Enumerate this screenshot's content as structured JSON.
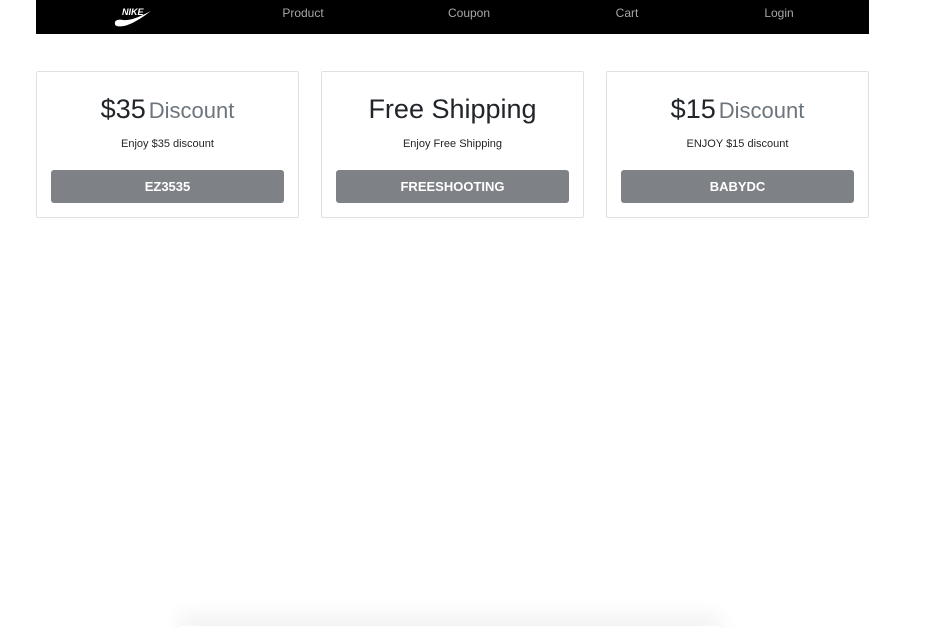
{
  "navbar": {
    "logo_text": "NIKE",
    "links": [
      {
        "label": "Product"
      },
      {
        "label": "Coupon"
      },
      {
        "label": "Cart"
      },
      {
        "label": "Login"
      }
    ]
  },
  "coupons": [
    {
      "title_main": "$35",
      "title_sub": "Discount",
      "description": "Enjoy $35 discount",
      "code": "EZ3535"
    },
    {
      "title_main": "Free Shipping",
      "title_sub": "",
      "description": "Enjoy Free Shipping",
      "code": "FREESHOOTING"
    },
    {
      "title_main": "$15",
      "title_sub": "Discount",
      "description": "ENJOY $15 discount",
      "code": "BABYDC"
    }
  ],
  "colors": {
    "navbar_bg": "#000000",
    "nav_link": "#a7a7a7",
    "button_bg": "#7e8186",
    "muted_text": "#6c757d"
  },
  "icons": {
    "logo": "nike-swoosh-icon"
  }
}
